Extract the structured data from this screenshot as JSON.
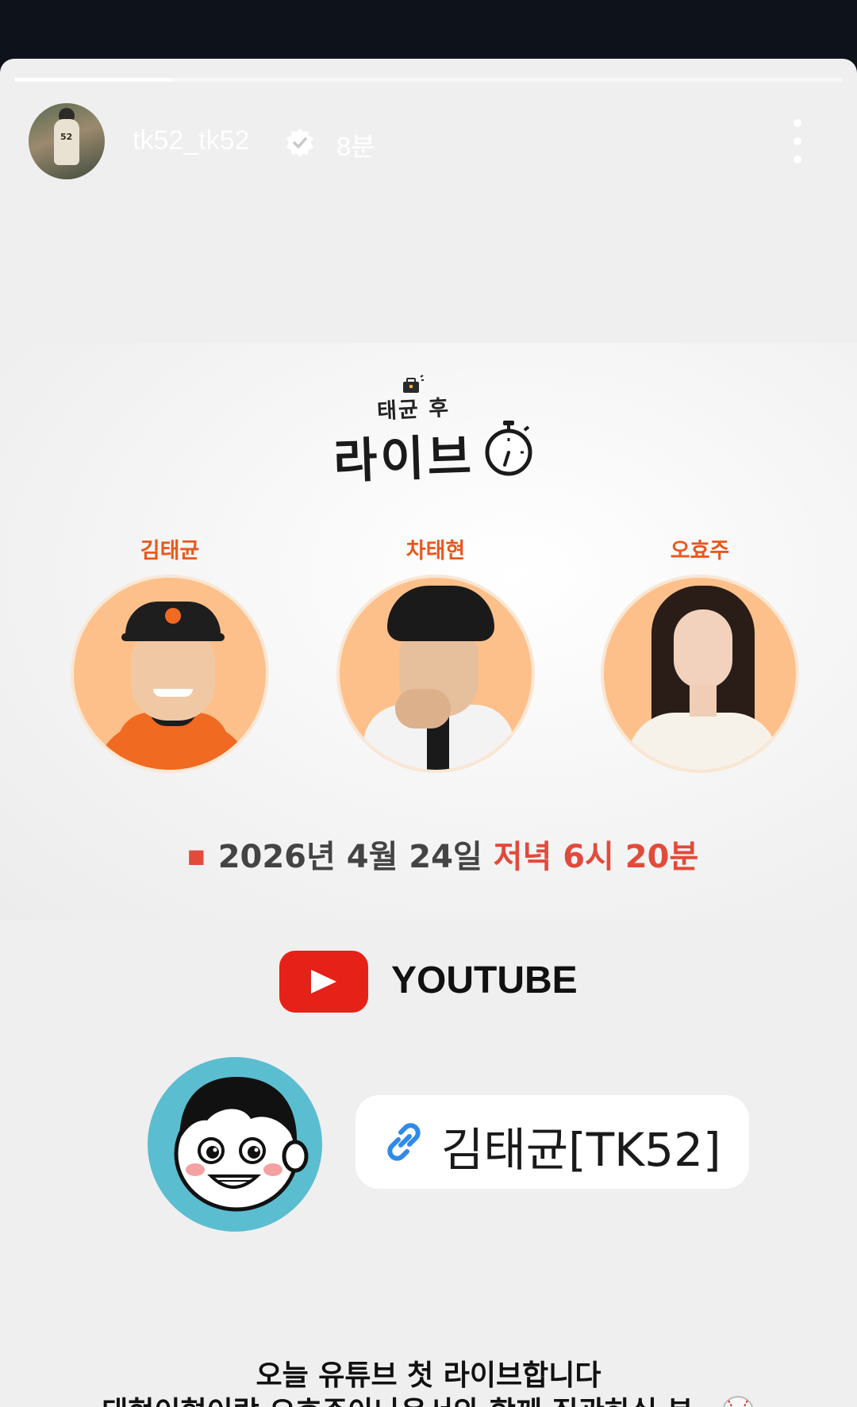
{
  "story": {
    "progress": 0.19,
    "username": "tk52_tk52",
    "time_ago": "8분",
    "verified": true
  },
  "card": {
    "show_subtitle": "태균 후",
    "show_title": "라이브",
    "hosts": [
      {
        "name": "김태균"
      },
      {
        "name": "차태현"
      },
      {
        "name": "오효주"
      }
    ],
    "date_text": "2026년 4월 24일",
    "time_text": "저녁 6시 20분"
  },
  "youtube": {
    "label": "YOUTUBE"
  },
  "channel": {
    "link_text": "김태균[TK52]"
  },
  "caption": {
    "line1": "오늘 유튜브 첫 라이브합니다",
    "line2": "태현이형이랑 오효주아나운서와 함께 집관하실 분~"
  },
  "colors": {
    "accent_orange": "#e8581e",
    "date_red": "#e24a3b",
    "youtube_red": "#e62117",
    "channel_avatar_bg": "#5bbdd0",
    "host_photo_bg": "#fdc08a"
  },
  "icons": [
    "verified-badge-icon",
    "more-options-icon",
    "briefcase-icon",
    "stopwatch-icon",
    "youtube-play-icon",
    "link-icon",
    "baseball-icon"
  ]
}
